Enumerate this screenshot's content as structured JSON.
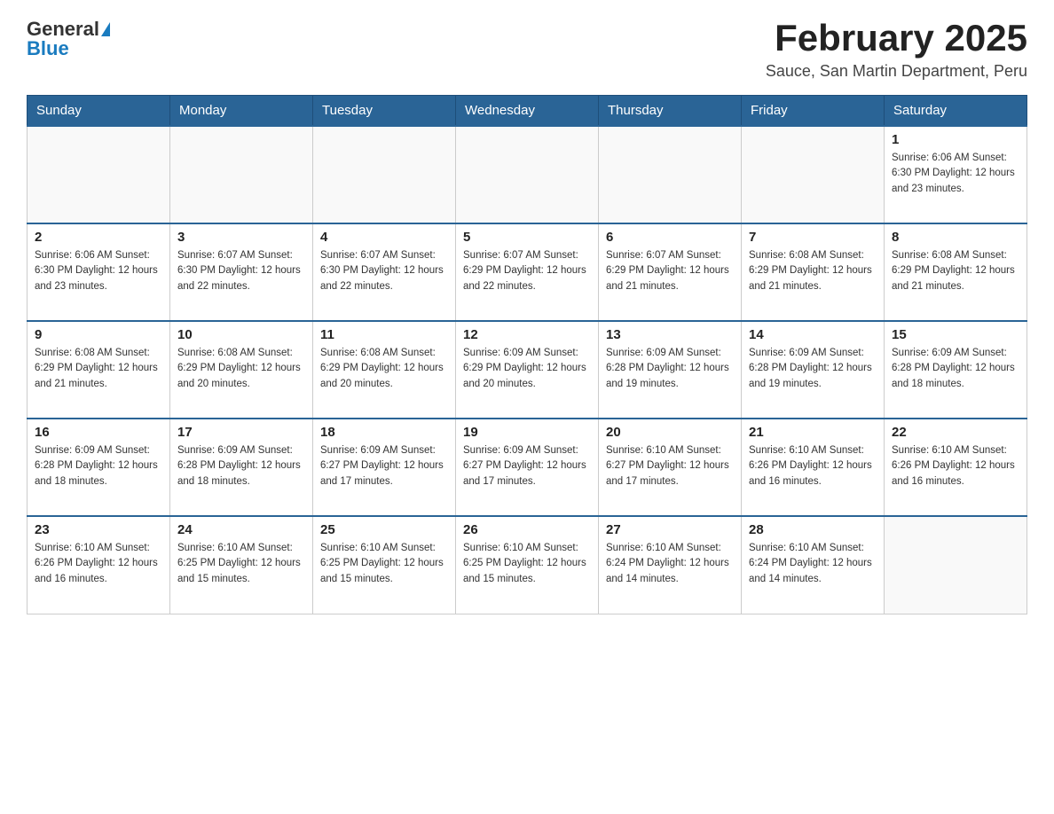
{
  "header": {
    "logo_general": "General",
    "logo_blue": "Blue",
    "month_title": "February 2025",
    "location": "Sauce, San Martin Department, Peru"
  },
  "weekdays": [
    "Sunday",
    "Monday",
    "Tuesday",
    "Wednesday",
    "Thursday",
    "Friday",
    "Saturday"
  ],
  "weeks": [
    [
      {
        "day": "",
        "info": ""
      },
      {
        "day": "",
        "info": ""
      },
      {
        "day": "",
        "info": ""
      },
      {
        "day": "",
        "info": ""
      },
      {
        "day": "",
        "info": ""
      },
      {
        "day": "",
        "info": ""
      },
      {
        "day": "1",
        "info": "Sunrise: 6:06 AM\nSunset: 6:30 PM\nDaylight: 12 hours and 23 minutes."
      }
    ],
    [
      {
        "day": "2",
        "info": "Sunrise: 6:06 AM\nSunset: 6:30 PM\nDaylight: 12 hours and 23 minutes."
      },
      {
        "day": "3",
        "info": "Sunrise: 6:07 AM\nSunset: 6:30 PM\nDaylight: 12 hours and 22 minutes."
      },
      {
        "day": "4",
        "info": "Sunrise: 6:07 AM\nSunset: 6:30 PM\nDaylight: 12 hours and 22 minutes."
      },
      {
        "day": "5",
        "info": "Sunrise: 6:07 AM\nSunset: 6:29 PM\nDaylight: 12 hours and 22 minutes."
      },
      {
        "day": "6",
        "info": "Sunrise: 6:07 AM\nSunset: 6:29 PM\nDaylight: 12 hours and 21 minutes."
      },
      {
        "day": "7",
        "info": "Sunrise: 6:08 AM\nSunset: 6:29 PM\nDaylight: 12 hours and 21 minutes."
      },
      {
        "day": "8",
        "info": "Sunrise: 6:08 AM\nSunset: 6:29 PM\nDaylight: 12 hours and 21 minutes."
      }
    ],
    [
      {
        "day": "9",
        "info": "Sunrise: 6:08 AM\nSunset: 6:29 PM\nDaylight: 12 hours and 21 minutes."
      },
      {
        "day": "10",
        "info": "Sunrise: 6:08 AM\nSunset: 6:29 PM\nDaylight: 12 hours and 20 minutes."
      },
      {
        "day": "11",
        "info": "Sunrise: 6:08 AM\nSunset: 6:29 PM\nDaylight: 12 hours and 20 minutes."
      },
      {
        "day": "12",
        "info": "Sunrise: 6:09 AM\nSunset: 6:29 PM\nDaylight: 12 hours and 20 minutes."
      },
      {
        "day": "13",
        "info": "Sunrise: 6:09 AM\nSunset: 6:28 PM\nDaylight: 12 hours and 19 minutes."
      },
      {
        "day": "14",
        "info": "Sunrise: 6:09 AM\nSunset: 6:28 PM\nDaylight: 12 hours and 19 minutes."
      },
      {
        "day": "15",
        "info": "Sunrise: 6:09 AM\nSunset: 6:28 PM\nDaylight: 12 hours and 18 minutes."
      }
    ],
    [
      {
        "day": "16",
        "info": "Sunrise: 6:09 AM\nSunset: 6:28 PM\nDaylight: 12 hours and 18 minutes."
      },
      {
        "day": "17",
        "info": "Sunrise: 6:09 AM\nSunset: 6:28 PM\nDaylight: 12 hours and 18 minutes."
      },
      {
        "day": "18",
        "info": "Sunrise: 6:09 AM\nSunset: 6:27 PM\nDaylight: 12 hours and 17 minutes."
      },
      {
        "day": "19",
        "info": "Sunrise: 6:09 AM\nSunset: 6:27 PM\nDaylight: 12 hours and 17 minutes."
      },
      {
        "day": "20",
        "info": "Sunrise: 6:10 AM\nSunset: 6:27 PM\nDaylight: 12 hours and 17 minutes."
      },
      {
        "day": "21",
        "info": "Sunrise: 6:10 AM\nSunset: 6:26 PM\nDaylight: 12 hours and 16 minutes."
      },
      {
        "day": "22",
        "info": "Sunrise: 6:10 AM\nSunset: 6:26 PM\nDaylight: 12 hours and 16 minutes."
      }
    ],
    [
      {
        "day": "23",
        "info": "Sunrise: 6:10 AM\nSunset: 6:26 PM\nDaylight: 12 hours and 16 minutes."
      },
      {
        "day": "24",
        "info": "Sunrise: 6:10 AM\nSunset: 6:25 PM\nDaylight: 12 hours and 15 minutes."
      },
      {
        "day": "25",
        "info": "Sunrise: 6:10 AM\nSunset: 6:25 PM\nDaylight: 12 hours and 15 minutes."
      },
      {
        "day": "26",
        "info": "Sunrise: 6:10 AM\nSunset: 6:25 PM\nDaylight: 12 hours and 15 minutes."
      },
      {
        "day": "27",
        "info": "Sunrise: 6:10 AM\nSunset: 6:24 PM\nDaylight: 12 hours and 14 minutes."
      },
      {
        "day": "28",
        "info": "Sunrise: 6:10 AM\nSunset: 6:24 PM\nDaylight: 12 hours and 14 minutes."
      },
      {
        "day": "",
        "info": ""
      }
    ]
  ]
}
